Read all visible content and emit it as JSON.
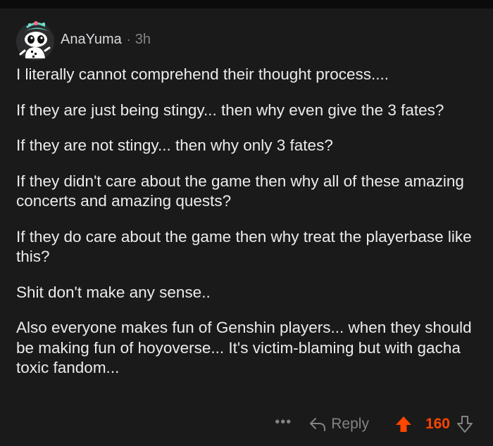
{
  "comment": {
    "username": "AnaYuma",
    "separator": "·",
    "time": "3h",
    "paragraphs": [
      "I literally cannot comprehend their thought process....",
      "If they are just being stingy... then why even give the 3 fates?",
      "If they are not stingy... then why only 3 fates?",
      "If they didn't care about the game then why all of these amazing concerts and amazing quests?",
      "If they do care about the game then why treat the playerbase like this?",
      "Shit don't make any sense..",
      "Also everyone makes fun of Genshin players... when they should be making fun of hoyoverse... It's victim-blaming but with gacha toxic fandom..."
    ]
  },
  "actions": {
    "more_label": "•••",
    "reply_label": "Reply",
    "score": "160"
  },
  "colors": {
    "background": "#1a1a1b",
    "text": "#d7dadc",
    "muted": "#818384",
    "upvote": "#ff4500"
  },
  "icons": {
    "avatar": "reddit-snoo-avatar",
    "reply": "reply-arrow-icon",
    "upvote": "upvote-arrow-icon",
    "downvote": "downvote-arrow-icon"
  }
}
